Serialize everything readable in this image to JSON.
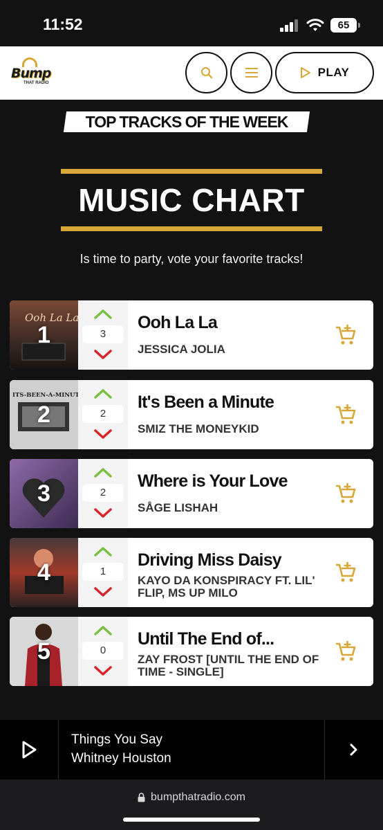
{
  "status_bar": {
    "time": "11:52",
    "battery": "65"
  },
  "header": {
    "logo_text": "Bump",
    "logo_sub": "THAT RADIO",
    "play_label": "PLAY",
    "accent": "#d7a737"
  },
  "hero": {
    "tag": "TOP TRACKS OF THE WEEK",
    "title": "MUSIC CHART",
    "subtitle": "Is time to party, vote your favorite tracks!"
  },
  "tracks": [
    {
      "rank": "1",
      "votes": "3",
      "title": "Ooh La La",
      "artist": "JESSICA JOLIA"
    },
    {
      "rank": "2",
      "votes": "2",
      "title": "It's Been a Minute",
      "artist": "SMIZ THE MONEYKID"
    },
    {
      "rank": "3",
      "votes": "2",
      "title": "Where is Your Love",
      "artist": "SÅGE LISHAH"
    },
    {
      "rank": "4",
      "votes": "1",
      "title": "Driving Miss Daisy",
      "artist": "KAYO DA KONSPIRACY FT. LIL' FLIP, MS UP MILO"
    },
    {
      "rank": "5",
      "votes": "0",
      "title": "Until The End of...",
      "artist": "ZAY FROST [UNTIL THE END OF TIME - SINGLE]"
    }
  ],
  "player": {
    "now_title": "Things You Say",
    "now_artist": "Whitney Houston"
  },
  "browser": {
    "url": "bumpthatradio.com"
  },
  "colors": {
    "up": "#7ac143",
    "down": "#d9232a",
    "gold": "#d7a737"
  }
}
